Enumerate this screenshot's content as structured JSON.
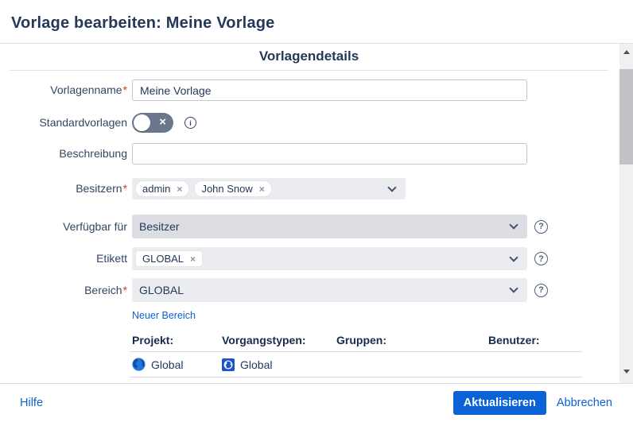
{
  "modal": {
    "title": "Vorlage bearbeiten: Meine Vorlage",
    "section_title": "Vorlagendetails"
  },
  "form": {
    "template_name": {
      "label": "Vorlagenname",
      "required": "*",
      "value": "Meine Vorlage"
    },
    "default_templates": {
      "label": "Standardvorlagen",
      "state": "off"
    },
    "description": {
      "label": "Beschreibung",
      "value": ""
    },
    "owners": {
      "label": "Besitzern",
      "required": "*",
      "tags": [
        {
          "text": "admin",
          "remove": "×"
        },
        {
          "text": "John Snow",
          "remove": "×"
        }
      ]
    },
    "available_for": {
      "label": "Verfügbar für",
      "value": "Besitzer"
    },
    "etikett": {
      "label": "Etikett",
      "tags": [
        {
          "text": "GLOBAL",
          "remove": "×"
        }
      ]
    },
    "bereich": {
      "label": "Bereich",
      "required": "*",
      "value": "GLOBAL"
    },
    "new_scope_link": "Neuer Bereich"
  },
  "table": {
    "headers": [
      "Projekt:",
      "Vorgangstypen:",
      "Gruppen:",
      "Benutzer:"
    ],
    "rows": [
      {
        "projekt": "Global",
        "vorgangstypen": "Global",
        "gruppen": "",
        "benutzer": ""
      }
    ]
  },
  "footer": {
    "help": "Hilfe",
    "update": "Aktualisieren",
    "cancel": "Abbrechen"
  },
  "icons": {
    "info": "i",
    "question": "?",
    "toggle_off": "×"
  },
  "colors": {
    "accent": "#0B62D6",
    "title_text": "#253858",
    "label_text": "#344563",
    "required": "#DE350B",
    "toggle_off_bg": "#6B778C",
    "select_bg": "#EBECF0",
    "select_bg_active": "#DCDEE4"
  }
}
